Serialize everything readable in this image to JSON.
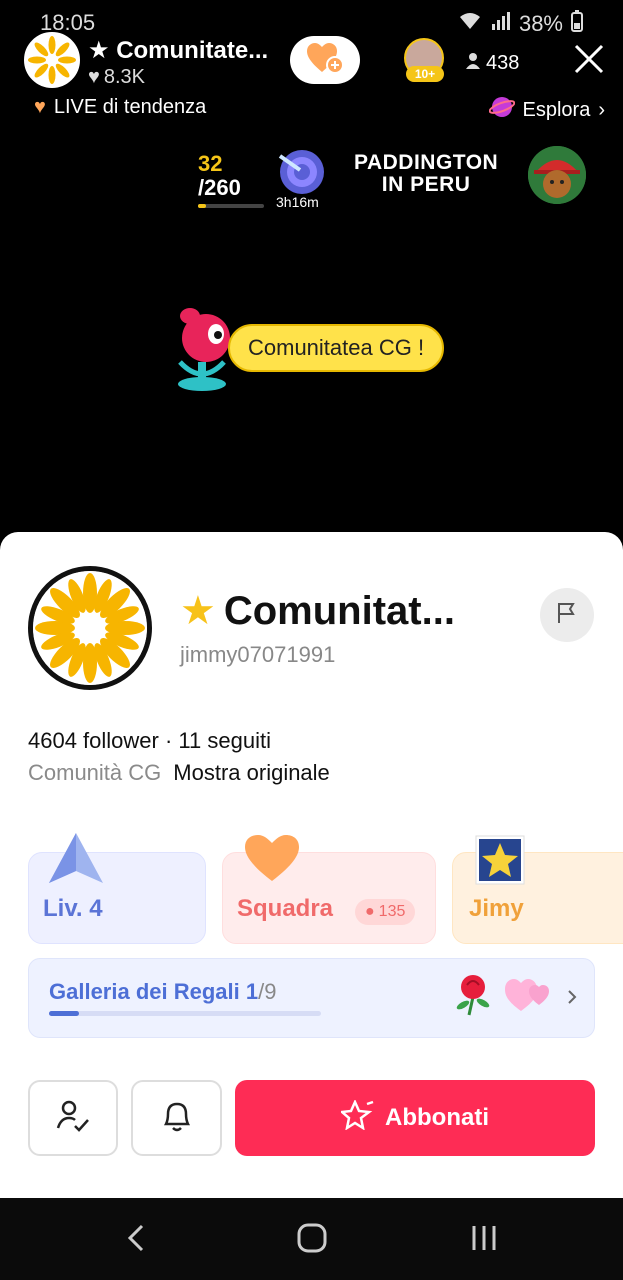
{
  "status_bar": {
    "time": "18:05",
    "battery": "38%"
  },
  "live": {
    "host_name": "Comunitate...",
    "host_likes": "8.3K",
    "viewer_badge": "10+",
    "viewer_count": "438",
    "trending_label": "LIVE di tendenza",
    "explore_label": "Esplora"
  },
  "goal": {
    "current": "32",
    "total": "/260",
    "progress": 0.12,
    "timer": "3h16m"
  },
  "promo": {
    "line1": "PADDINGTON",
    "line2": "IN PERU"
  },
  "speech": {
    "text": "Comunitatea CG !"
  },
  "profile": {
    "name": "Comunitat...",
    "handle": "jimmy07071991",
    "stats": "4604 follower · 11 seguiti",
    "bio": "Comunità CG",
    "show_original": "Mostra originale",
    "level_label": "Liv. 4",
    "team_label": "Squadra",
    "team_count": "135",
    "fan_label": "Jimy",
    "gallery_label": "Galleria dei Regali",
    "gallery_num": "1",
    "gallery_total": "/9",
    "gallery_progress": 0.11,
    "subscribe_label": "Abbonati"
  },
  "colors": {
    "accent": "#fe2c55",
    "gold": "#f5c518",
    "level_blue": "#5b74d6",
    "team_red": "#f06a6a",
    "fan_orange": "#f0a13a"
  }
}
